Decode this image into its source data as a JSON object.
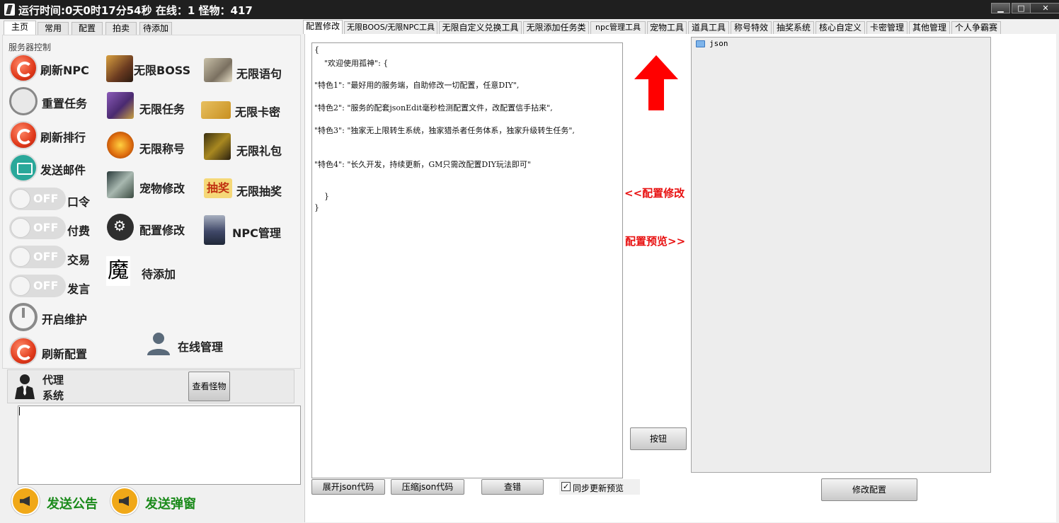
{
  "window": {
    "title": "运行时间:0天0时17分54秒  在线：1  怪物：417",
    "minimize": "▁",
    "maximize": "□",
    "close": "✕"
  },
  "left_tabs": [
    "主页",
    "常用",
    "配置",
    "拍卖",
    "待添加"
  ],
  "server_control": {
    "label": "服务器控制",
    "col1": [
      "刷新NPC",
      "重置任务",
      "刷新排行",
      "发送邮件"
    ],
    "toggles": [
      {
        "state": "OFF",
        "label": "口令"
      },
      {
        "state": "OFF",
        "label": "付费"
      },
      {
        "state": "OFF",
        "label": "交易"
      },
      {
        "state": "OFF",
        "label": "发言"
      }
    ],
    "maintenance": "开启维护",
    "refresh_config": "刷新配置",
    "col2": [
      "无限BOSS",
      "无限任务",
      "无限称号",
      "宠物修改",
      "配置修改",
      "待添加"
    ],
    "col3": [
      "无限语句",
      "无限卡密",
      "无限礼包",
      "无限抽奖",
      "NPC管理"
    ],
    "lottery_badge": "抽奖",
    "demon_glyph": "魔",
    "online_manage": "在线管理"
  },
  "agent": {
    "label_line1": "代理",
    "label_line2": "系统",
    "view_monsters": "查看怪物"
  },
  "bottom_buttons": {
    "announce": "发送公告",
    "popup": "发送弹窗"
  },
  "right_tabs": [
    "配置修改",
    "无限BOOS/无限NPC工具",
    "无限自定义兑换工具",
    "无限添加任务类",
    "npc管理工具",
    "宠物工具",
    "道具工具",
    "称号特效",
    "抽奖系统",
    "核心自定义",
    "卡密管理",
    "其他管理",
    "个人争霸赛"
  ],
  "editor": {
    "lines": [
      "{",
      "    \"欢迎使用孤神\": {",
      "\"特色1\": \"最好用的服务端，自助修改一切配置，任意DIY\",",
      "\"特色2\": \"服务的配套jsonEdit毫秒检测配置文件，改配置信手拈来\",",
      "\"特色3\": \"独家无上限转生系统，独家猎杀者任务体系，独家升级转生任务\",",
      "\"特色4\": \"长久开发，持续更新，GM只需改配置DIY玩法即可\"",
      "    }",
      "}"
    ]
  },
  "middle": {
    "config_edit": "<<配置修改",
    "config_preview": "配置预览>>",
    "button": "按钮"
  },
  "editor_buttons": {
    "expand": "展开json代码",
    "compress": "压缩json代码",
    "check": "查错",
    "sync": "同步更新预览",
    "sync_mark": "✓"
  },
  "tree": {
    "root": "json"
  },
  "modify_config": "修改配置",
  "colors": {
    "title_bar": "#1f1f1f",
    "red_accent": "#e81010",
    "green_accent": "#1a8a1a"
  }
}
